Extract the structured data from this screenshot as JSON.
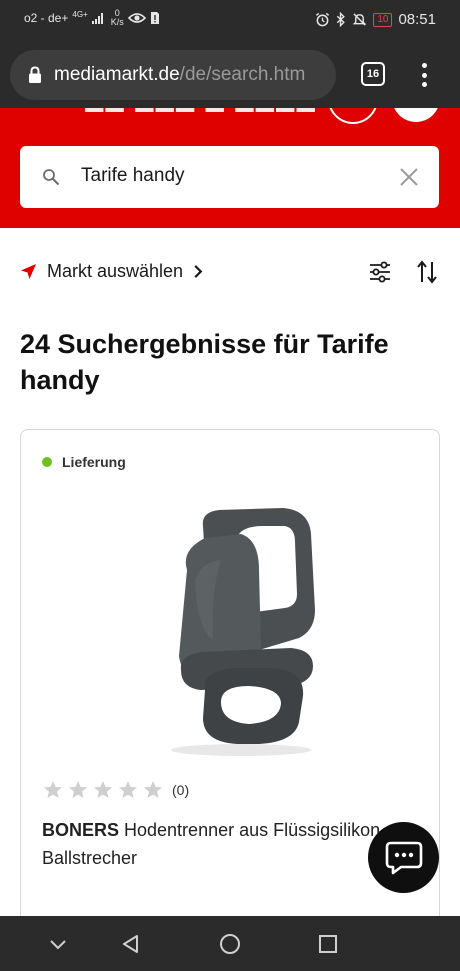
{
  "status_bar": {
    "carrier": "o2 - de+",
    "network": "4G+",
    "speed_value": "0",
    "speed_unit": "K/s",
    "battery": "10",
    "time": "08:51"
  },
  "browser": {
    "url_domain": "mediamarkt.de",
    "url_path": "/de/search.htm",
    "tab_count": "16"
  },
  "search": {
    "query": "Tarife handy"
  },
  "market": {
    "label": "Markt auswählen"
  },
  "results": {
    "heading": "24 Suchergebnisse für Tarife handy"
  },
  "product": {
    "delivery": "Lieferung",
    "rating_count": "(0)",
    "stars": 0,
    "brand": "BONERS",
    "title": " Hodentrenner aus Flüssigsilikon Ballstrecher"
  },
  "colors": {
    "brand_red": "#df0000",
    "available_green": "#6cc11d",
    "chrome_dark": "#2b2b2b"
  }
}
